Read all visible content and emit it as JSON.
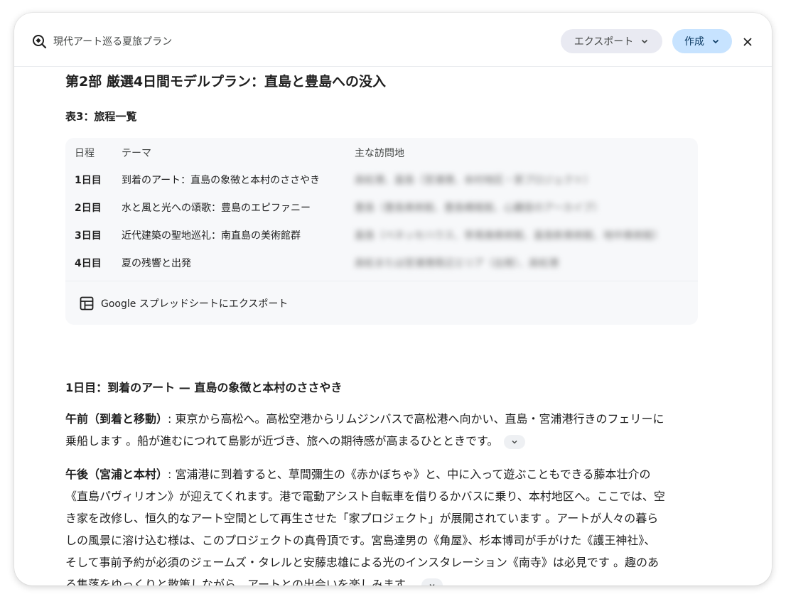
{
  "header": {
    "title": "現代アート巡る夏旅プラン",
    "export_label": "エクスポート",
    "create_label": "作成"
  },
  "main": {
    "part_title": "第2部 厳選4日間モデルプラン：直島と豊島への没入",
    "table_caption": "表3：旅程一覧",
    "table": {
      "headers": [
        "日程",
        "テーマ",
        "主な訪問地"
      ],
      "rows": [
        {
          "day": "1日目",
          "theme": "到着のアート：直島の象徴と本村のささやき",
          "places": "高松港、直島（宮浦港、本村地区・家プロジェクト）"
        },
        {
          "day": "2日目",
          "theme": "水と風と光への頌歌：豊島のエピファニー",
          "places": "豊島（豊島美術館、豊島横尾館、心臓音のアーカイブ）"
        },
        {
          "day": "3日目",
          "theme": "近代建築の聖地巡礼：南直島の美術館群",
          "places": "直島（ベネッセハウス、李禹煥美術館、直島新美術館、地中美術館）"
        },
        {
          "day": "4日目",
          "theme": "夏の残響と出発",
          "places": "高松または宮浦港周辺エリア（出発）、高松港"
        }
      ],
      "export_label": "Google スプレッドシートにエクスポート"
    },
    "day1_heading": "1日目：到着のアート — 直島の象徴と本村のささやき",
    "morning_label": "午前（到着と移動）",
    "morning_text_line1": ": 東京から高松へ。高松空港からリムジンバスで高松港へ向かい、直島・宮浦港行きのフェリーに",
    "morning_text_line2": "乗船します 。船が進むにつれて島影が近づき、旅への期待感が高まるひとときです。",
    "afternoon_label": "午後（宮浦と本村）",
    "afternoon_line1": ": 宮浦港に到着すると、草間彌生の《赤かぼちゃ》と、中に入って遊ぶこともできる藤本壮介の",
    "afternoon_line2": "《直島パヴィリオン》が迎えてくれます。港で電動アシスト自転車を借りるかバスに乗り、本村地区へ。ここでは、空",
    "afternoon_line3": "き家を改修し、恒久的なアート空間として再生させた「家プロジェクト」が展開されています 。アートが人々の暮ら",
    "afternoon_line4": "しの風景に溶け込む様は、このプロジェクトの真骨頂です。宮島達男の《角屋》、杉本博司が手がけた《護王神社》、",
    "afternoon_line5": "そして事前予約が必須のジェームズ・タレルと安藤忠雄による光のインスタレーション《南寺》は必見です 。趣のあ",
    "afternoon_line6": "る集落をゆっくりと散策しながら、アートとの出会いを楽しみます。"
  },
  "colors": {
    "create_button_bg": "#c7e3ff",
    "export_button_bg": "#e9eaf2",
    "table_bg": "#f7f8fa"
  },
  "icons": [
    "explore-logo-icon",
    "chevron-down-icon",
    "close-icon",
    "table-grid-icon"
  ]
}
